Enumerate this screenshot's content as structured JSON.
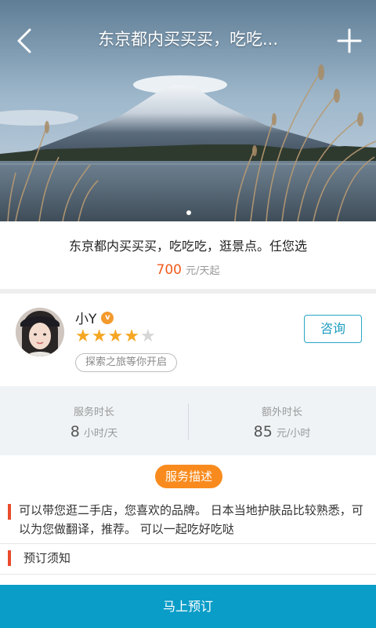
{
  "header": {
    "title": "东京都内买买买，吃吃...",
    "back_icon": "back-icon",
    "add_icon": "plus-icon"
  },
  "hero": {
    "image": "mount-fuji-lake-photo",
    "carousel_active_index": 0
  },
  "summary": {
    "title": "东京都内买买买，吃吃吃，逛景点。任您选",
    "price": "700",
    "price_unit": "元/天起"
  },
  "guide": {
    "name": "小Y",
    "verified_badge": "v",
    "rating": 4,
    "rating_max": 5,
    "tag": "探索之旅等你开启",
    "consult_label": "咨询"
  },
  "stats": {
    "service_label": "服务时长",
    "service_value": "8",
    "service_unit": "小时/天",
    "extra_label": "额外时长",
    "extra_value": "85",
    "extra_unit": "元/小时"
  },
  "description": {
    "pill_label": "服务描述",
    "text": "可以带您逛二手店，您喜欢的品牌。 日本当地护肤品比较熟悉，可以为您做翻译，推荐。 可以一起吃好吃哒"
  },
  "notice": {
    "label": "预订须知"
  },
  "footer": {
    "book_label": "马上预订"
  },
  "colors": {
    "accent": "#0a9dc8",
    "price": "#f05a1a",
    "pill": "#f98b1e",
    "star": "#f5a623",
    "marker": "#e94b2b"
  }
}
